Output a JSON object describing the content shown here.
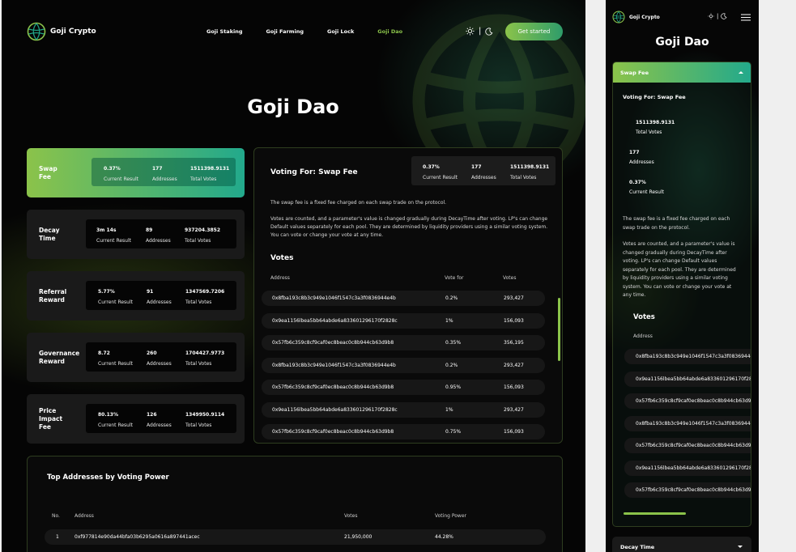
{
  "brand": {
    "name": "Goji Crypto"
  },
  "nav": {
    "items": [
      {
        "label": "Goji Staking",
        "active": false
      },
      {
        "label": "Goji Farming",
        "active": false
      },
      {
        "label": "Goji Lock",
        "active": false
      },
      {
        "label": "Goji Dao",
        "active": true
      }
    ]
  },
  "theme_toggle": {
    "separator": "|"
  },
  "cta": {
    "label": "Get started"
  },
  "page": {
    "title": "Goji Dao"
  },
  "cards": [
    {
      "label": "Swap\nFee",
      "result": "0.37%",
      "addresses": "177",
      "votes": "1511398.9131",
      "active": true
    },
    {
      "label": "Decay\nTime",
      "result": "3m 14s",
      "addresses": "89",
      "votes": "937204.3852",
      "active": false
    },
    {
      "label": "Referral\nReward",
      "result": "5.77%",
      "addresses": "91",
      "votes": "1347569.7206",
      "active": false
    },
    {
      "label": "Governance\nReward",
      "result": "8.72",
      "addresses": "260",
      "votes": "1704427.9773",
      "active": false
    },
    {
      "label": "Price\nImpact\nFee",
      "result": "80.13%",
      "addresses": "126",
      "votes": "1349950.9114",
      "active": false
    }
  ],
  "stat_labels": {
    "result": "Current Result",
    "addresses": "Addresses",
    "votes": "Total Votes"
  },
  "panel": {
    "title": "Voting For: Swap Fee",
    "result": "0.37%",
    "addresses": "177",
    "votes": "1511398.9131",
    "desc1": "The swap fee is a fixed fee charged on each swap trade on the protocol.",
    "desc2": "Votes are counted, and a parameter's value is changed gradually during DecayTime after voting. LP's can change Default values separately for each pool. They are determined by liquidity providers using a similar voting system. You can vote or change your vote at any time.",
    "votes_heading": "Votes",
    "columns": {
      "address": "Address",
      "vote_for": "Vote for",
      "votes": "Votes"
    },
    "rows": [
      {
        "address": "0x8fba193c8b3c949e1046f1547c3a3f0836944e4b",
        "vote_for": "0.2%",
        "votes": "293,427"
      },
      {
        "address": "0x9ea1156lbea5bb64abde6a833601296170f2828c",
        "vote_for": "1%",
        "votes": "156,093"
      },
      {
        "address": "0x57fb6c359c8cf9caf0ec8beac0c8b944cb63d9b8",
        "vote_for": "0.35%",
        "votes": "356,195"
      },
      {
        "address": "0x8fba193c8b3c949e1046f1547c3a3f0836944e4b",
        "vote_for": "0.2%",
        "votes": "293,427"
      },
      {
        "address": "0x57fb6c359c8cf9caf0ec8beac0c8b944cb63d9b8",
        "vote_for": "0.95%",
        "votes": "156,093"
      },
      {
        "address": "0x9ea1156lbea5bb64abde6a833601296170f2828c",
        "vote_for": "1%",
        "votes": "293,427"
      },
      {
        "address": "0x57fb6c359c8cf9caf0ec8beac0c8b944cb63d9b8",
        "vote_for": "0.75%",
        "votes": "156,093"
      }
    ]
  },
  "top": {
    "title": "Top Addresses by Voting Power",
    "columns": {
      "no": "No.",
      "address": "Address",
      "votes": "Votes",
      "power": "Voting Power"
    },
    "rows": [
      {
        "no": "1",
        "address": "0xf977814e90da44bfa03b6295a0616a897441acec",
        "votes": "21,950,000",
        "power": "44.28%"
      }
    ]
  },
  "mobile": {
    "title": "Goji Dao",
    "accordion": "Swap Fee",
    "voting_title": "Voting For: Swap Fee",
    "stats": [
      {
        "value": "1511398.9131",
        "label": "Total Votes"
      },
      {
        "value": "177",
        "label": "Addresses"
      },
      {
        "value": "0.37%",
        "label": "Current Result"
      }
    ],
    "votes_heading": "Votes",
    "address_header": "Address",
    "next_accordion": "Decay Time"
  },
  "colors": {
    "accent": "#8bc34a",
    "teal": "#22a98c",
    "bg": "#050505",
    "card": "#1a1a1a"
  }
}
